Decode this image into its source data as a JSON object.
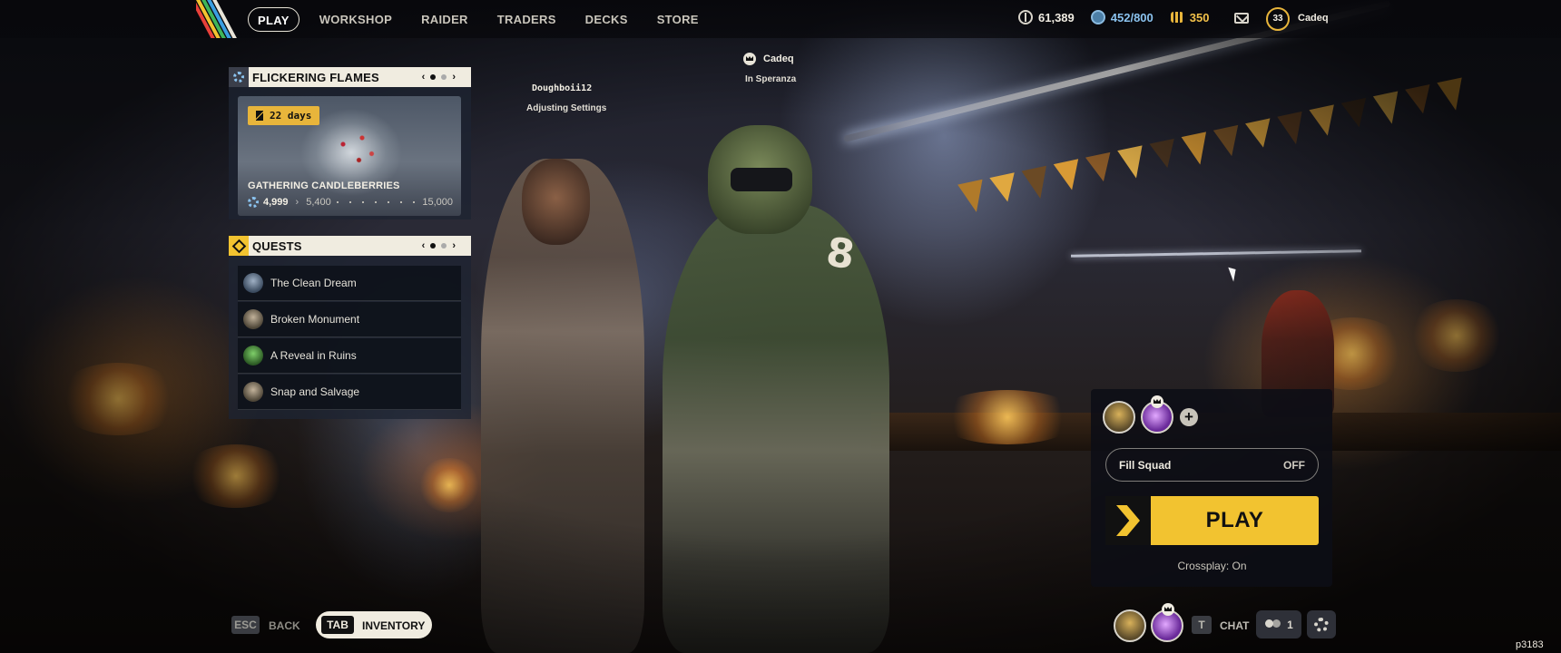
{
  "nav": {
    "items": [
      {
        "label": "PLAY",
        "active": true
      },
      {
        "label": "WORKSHOP"
      },
      {
        "label": "RAIDER"
      },
      {
        "label": "TRADERS"
      },
      {
        "label": "DECKS"
      },
      {
        "label": "STORE"
      }
    ]
  },
  "currencies": {
    "coins": "61,389",
    "credits": "452/800",
    "raider_tokens": "350"
  },
  "player": {
    "level": "33",
    "name": "Cadeq"
  },
  "event": {
    "title": "FLICKERING FLAMES",
    "days_left": "22 days",
    "card_title": "GATHERING CANDLEBERRIES",
    "progress_current": "4,999",
    "progress_next": "5,400",
    "progress_max": "15,000"
  },
  "quests": {
    "title": "QUESTS",
    "items": [
      {
        "label": "The Clean Dream"
      },
      {
        "label": "Broken Monument"
      },
      {
        "label": "A Reveal in Ruins"
      },
      {
        "label": "Snap and Salvage"
      }
    ]
  },
  "characters": {
    "leader_name": "Cadeq",
    "leader_status": "In Speranza",
    "teammate_name": "Doughboii12",
    "teammate_status": "Adjusting Settings"
  },
  "squad": {
    "fill_label": "Fill Squad",
    "fill_state": "OFF",
    "play_label": "PLAY",
    "crossplay": "Crossplay: On"
  },
  "bottom": {
    "esc_key": "ESC",
    "back_label": "BACK",
    "tab_key": "TAB",
    "inventory_label": "INVENTORY",
    "chat_key": "T",
    "chat_label": "CHAT",
    "friends_count": "1",
    "build_id": "p3183"
  },
  "colors": {
    "accent_yellow": "#f2c330",
    "credit_blue": "#8bc3ef",
    "panel_header": "#f0ece0"
  }
}
